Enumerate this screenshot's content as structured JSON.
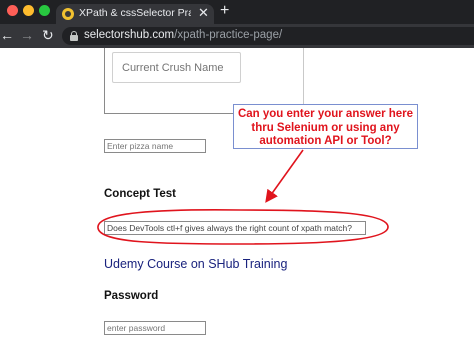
{
  "browser": {
    "tab_title": "XPath & cssSelector Practice P",
    "tab_close_glyph": "✕",
    "new_tab_glyph": "+",
    "back_glyph": "←",
    "forward_glyph": "→",
    "reload_glyph": "↻",
    "url_domain": "selectorshub.com",
    "url_path": "/xpath-practice-page/",
    "icons": [
      "close-window-dot",
      "minimize-window-dot",
      "maximize-window-dot",
      "site-favicon",
      "lock-icon"
    ]
  },
  "page": {
    "crush_input_placeholder": "Current Crush Name",
    "callout_lines": [
      "Can you enter your answer here",
      "thru Selenium or using any",
      "automation API or Tool?"
    ],
    "pizza_input_placeholder": "Enter pizza name",
    "concept_heading": "Concept Test",
    "concept_input_value": "Does DevTools ctl+f gives always the right count of xpath match?",
    "udemy_link_text": "Udemy Course on SHub Training",
    "password_heading": "Password",
    "password_input_placeholder": "enter password"
  },
  "colors": {
    "annotation_red": "#e0141d",
    "link_blue": "#1a237e",
    "chrome_dark": "#202124",
    "chrome_toolbar": "#35363a"
  }
}
